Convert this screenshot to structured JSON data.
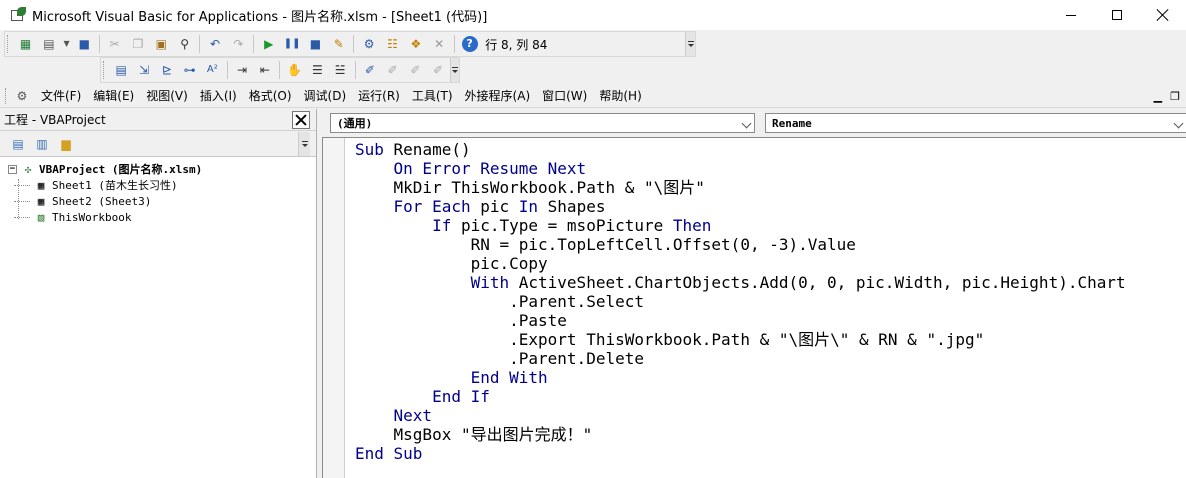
{
  "window": {
    "title": "Microsoft Visual Basic for Applications - 图片名称.xlsm - [Sheet1 (代码)]"
  },
  "toolbar": {
    "cursor_position": "行 8, 列 84",
    "standard_icons": [
      "view-excel-icon",
      "insert-module-icon",
      "save-icon",
      "cut-icon",
      "copy-icon",
      "paste-icon",
      "find-icon",
      "undo-icon",
      "redo-icon",
      "run-icon",
      "break-icon",
      "reset-icon",
      "design-mode-icon",
      "project-explorer-icon",
      "properties-icon",
      "object-browser-icon",
      "toolbox-icon",
      "help-icon"
    ],
    "edit_icons": [
      "list-properties-icon",
      "list-constants-icon",
      "quick-info-icon",
      "parameter-info-icon",
      "complete-word-icon",
      "indent-icon",
      "outdent-icon",
      "toggle-breakpoint-icon",
      "comment-block-icon",
      "uncomment-block-icon",
      "toggle-bookmark-icon",
      "next-bookmark-icon",
      "previous-bookmark-icon",
      "clear-bookmarks-icon"
    ]
  },
  "menu": {
    "items": [
      "文件(F)",
      "编辑(E)",
      "视图(V)",
      "插入(I)",
      "格式(O)",
      "调试(D)",
      "运行(R)",
      "工具(T)",
      "外接程序(A)",
      "窗口(W)",
      "帮助(H)"
    ]
  },
  "project": {
    "title": "工程 - VBAProject",
    "root": "VBAProject (图片名称.xlsm)",
    "children": [
      "Sheet1 (苗木生长习性)",
      "Sheet2 (Sheet3)",
      "ThisWorkbook"
    ]
  },
  "code_pane": {
    "object_combo": "(通用)",
    "procedure_combo": "Rename",
    "lines": [
      [
        {
          "t": "Sub",
          "k": true
        },
        {
          "t": " Rename()"
        }
      ],
      [
        {
          "t": "    "
        },
        {
          "t": "On Error Resume Next",
          "k": true
        }
      ],
      [
        {
          "t": "    MkDir ThisWorkbook.Path & \"\\图片\""
        }
      ],
      [
        {
          "t": "    "
        },
        {
          "t": "For Each",
          "k": true
        },
        {
          "t": " pic "
        },
        {
          "t": "In",
          "k": true
        },
        {
          "t": " Shapes"
        }
      ],
      [
        {
          "t": "        "
        },
        {
          "t": "If",
          "k": true
        },
        {
          "t": " pic.Type = msoPicture "
        },
        {
          "t": "Then",
          "k": true
        }
      ],
      [
        {
          "t": "            RN = pic.TopLeftCell.Offset(0, -3).Value"
        }
      ],
      [
        {
          "t": "            pic.Copy"
        }
      ],
      [
        {
          "t": "            "
        },
        {
          "t": "With",
          "k": true
        },
        {
          "t": " ActiveSheet.ChartObjects.Add(0, 0, pic.Width, pic.Height).Chart"
        }
      ],
      [
        {
          "t": "                .Parent.Select"
        }
      ],
      [
        {
          "t": "                .Paste"
        }
      ],
      [
        {
          "t": "                .Export ThisWorkbook.Path & \"\\图片\\\" & RN & \".jpg\""
        }
      ],
      [
        {
          "t": "                .Parent.Delete"
        }
      ],
      [
        {
          "t": "            "
        },
        {
          "t": "End With",
          "k": true
        }
      ],
      [
        {
          "t": "        "
        },
        {
          "t": "End If",
          "k": true
        }
      ],
      [
        {
          "t": "    "
        },
        {
          "t": "Next",
          "k": true
        }
      ],
      [
        {
          "t": "    MsgBox \"导出图片完成！\""
        }
      ],
      [
        {
          "t": "End Sub",
          "k": true
        }
      ]
    ]
  }
}
